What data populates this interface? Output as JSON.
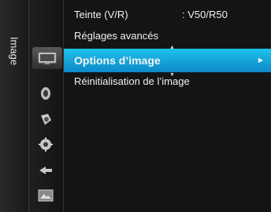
{
  "side_tab": {
    "label": "Image"
  },
  "icons": [
    {
      "name": "picture-icon",
      "active": true
    },
    {
      "name": "sound-icon",
      "active": false
    },
    {
      "name": "channel-icon",
      "active": false
    },
    {
      "name": "setup-icon",
      "active": false
    },
    {
      "name": "input-icon",
      "active": false
    },
    {
      "name": "application-icon",
      "active": false
    }
  ],
  "menu": {
    "items": [
      {
        "label": "Teinte (V/R)",
        "value": ": V50/R50"
      },
      {
        "label": "Réglages avancés",
        "value": ""
      },
      {
        "label": "Options d’image",
        "value": "",
        "selected": true
      },
      {
        "label": "Réinitialisation de l’image",
        "value": ""
      }
    ]
  },
  "colors": {
    "highlight": "#0d9ad8",
    "background": "#141414",
    "text": "#f2f2f2"
  }
}
